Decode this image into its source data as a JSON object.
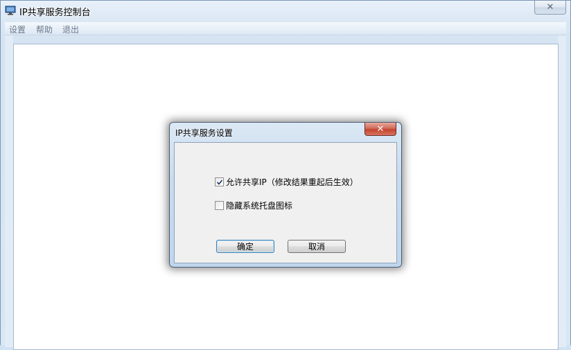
{
  "window": {
    "title": "IP共享服务控制台",
    "close_symbol": "✕"
  },
  "menu": [
    "设置",
    "帮助",
    "退出"
  ],
  "dialog": {
    "title": "IP共享服务设置",
    "close_symbol": "✕",
    "options": [
      {
        "label": "允许共享IP（修改结果重起后生效）",
        "checked": true
      },
      {
        "label": "隐藏系统托盘图标",
        "checked": false
      }
    ],
    "ok_label": "确定",
    "cancel_label": "取消"
  },
  "icons": {
    "app": "monitor-icon",
    "check": "checkmark-icon"
  },
  "colors": {
    "dialog_close": "#c7503b",
    "frame": "#d5e3f2"
  }
}
